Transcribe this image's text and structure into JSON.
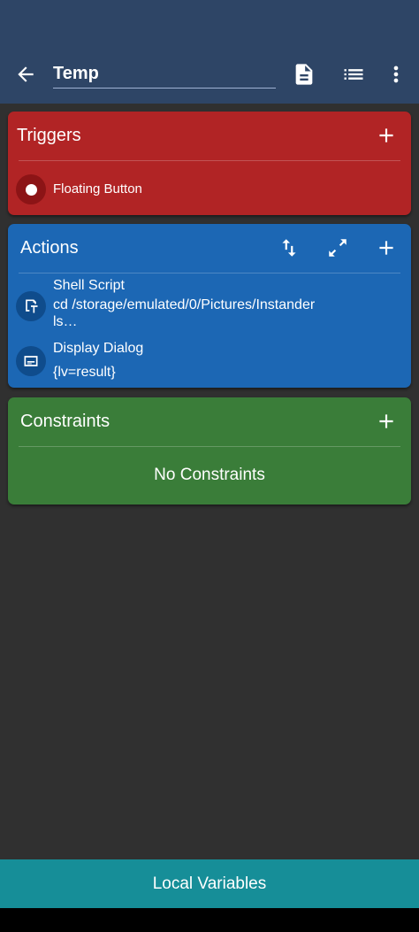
{
  "app": {
    "title": "Temp",
    "icons": [
      "back-arrow-icon",
      "document-icon",
      "list-icon",
      "more-vert-icon"
    ]
  },
  "triggers": {
    "title": "Triggers",
    "color": "#b12425",
    "items": [
      {
        "label": "Floating Button",
        "icon": "radio-dot-icon"
      }
    ]
  },
  "actions": {
    "title": "Actions",
    "color": "#1c67b4",
    "items": [
      {
        "title": "Shell Script",
        "detail": "cd /storage/emulated/0/Pictures/Instander",
        "detail2": "ls…",
        "icon": "terminal-icon"
      },
      {
        "title": "Display Dialog",
        "detail": "{lv=result}",
        "icon": "dialog-icon"
      }
    ]
  },
  "constraints": {
    "title": "Constraints",
    "color": "#3a7d39",
    "empty_label": "No Constraints"
  },
  "bottom": {
    "label": "Local Variables",
    "color": "#168e98"
  }
}
